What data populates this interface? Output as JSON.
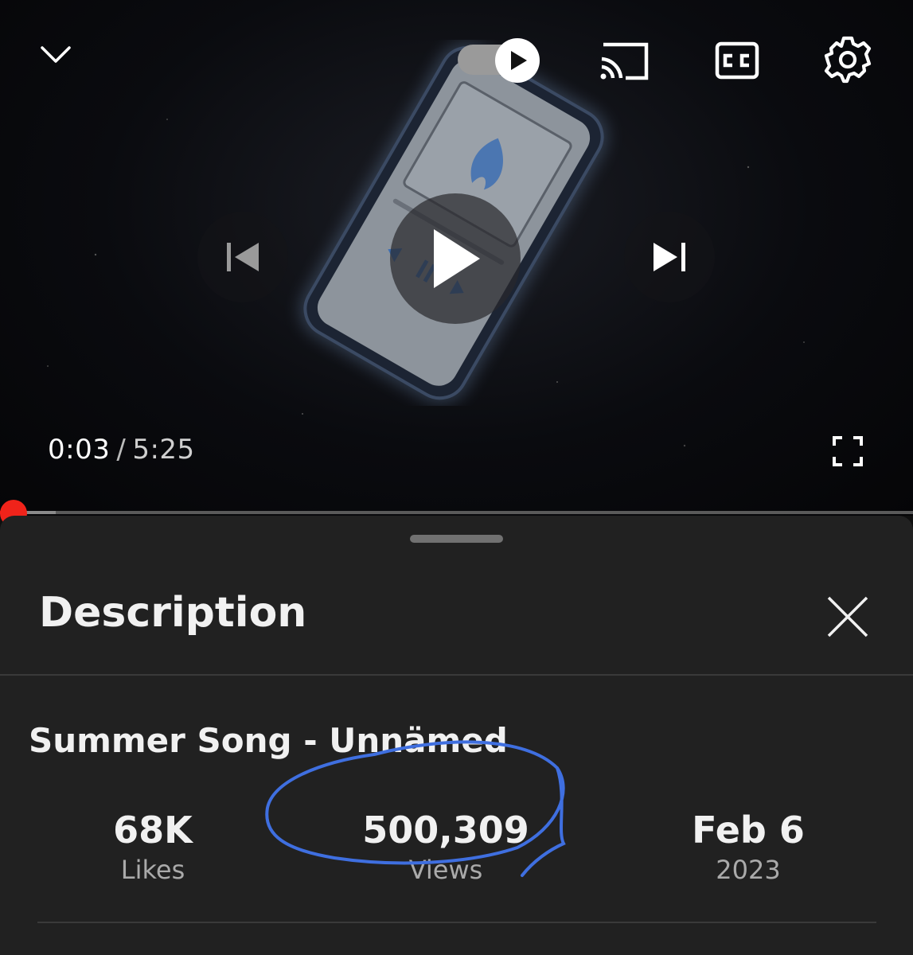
{
  "player": {
    "current_time": "0:03",
    "separator": "/",
    "duration": "5:25",
    "progress_fraction": 0.0092,
    "autoplay_on": true
  },
  "description": {
    "sheet_title": "Description",
    "video_title": "Summer Song - Unnämed",
    "stats": {
      "likes_value": "68K",
      "likes_label": "Likes",
      "views_value": "500,309",
      "views_label": "Views",
      "date_value": "Feb 6",
      "date_label": "2023"
    }
  },
  "colors": {
    "accent_red": "#ff0000",
    "annotation_blue": "#3f6fe0",
    "sheet_bg": "#212121"
  },
  "icons": {
    "minimize": "chevron-down-icon",
    "autoplay": "autoplay-toggle-icon",
    "cast": "cast-icon",
    "captions": "closed-captions-icon",
    "settings": "gear-icon",
    "previous": "skip-previous-icon",
    "play": "play-icon",
    "next": "skip-next-icon",
    "fullscreen": "fullscreen-icon",
    "close": "close-icon"
  }
}
